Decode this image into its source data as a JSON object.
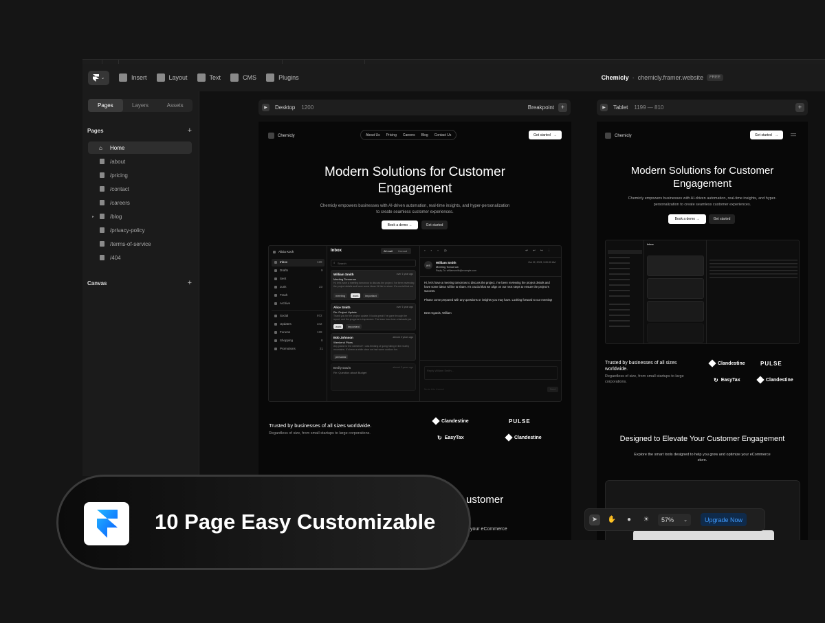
{
  "toolbar": {
    "insert": "Insert",
    "layout": "Layout",
    "text": "Text",
    "cms": "CMS",
    "plugins": "Plugins",
    "site_name": "Chemicly",
    "separator": "·",
    "domain": "chemicly.framer.website",
    "plan": "FREE"
  },
  "sidebar": {
    "tabs": [
      "Pages",
      "Layers",
      "Assets"
    ],
    "pages_title": "Pages",
    "pages": [
      "Home",
      "/about",
      "/pricing",
      "/contact",
      "/careers",
      "/blog",
      "/privacy-policy",
      "/terms-of-service",
      "/404"
    ],
    "canvas_title": "Canvas"
  },
  "desktop_bar": {
    "name": "Desktop",
    "dims": "1200",
    "breakpoint": "Breakpoint"
  },
  "tablet_bar": {
    "name": "Tablet",
    "dims": "1199 — 810"
  },
  "site": {
    "logo": "Chemicly",
    "nav": [
      "About Us",
      "Pricing",
      "Careers",
      "Blog",
      "Contact Us"
    ],
    "get_started": "Get started",
    "hero_title_1": "Modern Solutions for Customer",
    "hero_title_2": "Engagement",
    "hero_sub_1": "Chemicly empowers businesses with AI-driven automation, real-time insights, and hyper-personalization",
    "hero_sub_2": "to create seamless customer experiences.",
    "tablet_sub_1": "Chemicly empowers businesses with AI-driven automation, real-time insights, and hyper-",
    "tablet_sub_2": "personalization to create seamless customer experiences.",
    "book_demo": "Book a demo",
    "trusted": "Trusted by businesses of all sizes worldwide.",
    "trusted_t1": "Trusted by businesses of all sizes",
    "trusted_t2": "worldwide.",
    "regardless": "Regardless of size, from small startups to large corporations.",
    "regardless_t1": "Regardless of size, from small startups to large",
    "regardless_t2": "corporations.",
    "brands": [
      "Clandestine",
      "PULSE",
      "EasyTax",
      "Clandestine"
    ],
    "designed": "Designed to Elevate Your Customer Engagement",
    "explore_1": "Explore the smart tools designed to help you grow and optimize your eCommerce",
    "explore_2": "store.",
    "cut_1": "ustomer",
    "cut_2": "your eCommerce"
  },
  "inbox": {
    "account": "Alicia Koch",
    "title": "Inbox",
    "all_mail": "All mail",
    "unread": "Unread",
    "search": "Search",
    "folders": [
      {
        "name": "Inbox",
        "count": "128"
      },
      {
        "name": "Drafts",
        "count": "9"
      },
      {
        "name": "Sent",
        "count": ""
      },
      {
        "name": "Junk",
        "count": "23"
      },
      {
        "name": "Trash",
        "count": ""
      },
      {
        "name": "Archive",
        "count": ""
      }
    ],
    "categories": [
      {
        "name": "Social",
        "count": "972"
      },
      {
        "name": "Updates",
        "count": "342"
      },
      {
        "name": "Forums",
        "count": "128"
      },
      {
        "name": "Shopping",
        "count": "8"
      },
      {
        "name": "Promotions",
        "count": "21"
      }
    ],
    "mails": [
      {
        "from": "William Smith",
        "time": "over 1 year ago",
        "subject": "Meeting Tomorrow",
        "preview": "Hi, let's have a meeting tomorrow to discuss the project. I've been reviewing the project details and have some ideas I'd like to share. It's crucial that we align on our next steps to ensure the project's success.",
        "tags": [
          "meeting",
          "work",
          "important"
        ]
      },
      {
        "from": "Alice Smith",
        "time": "over 1 year ago",
        "subject": "Re: Project Update",
        "preview": "Thank you for the project update. It looks great! I've gone through the report, and the progress is impressive. The team has done a fantastic job.",
        "tags": [
          "work",
          "important"
        ]
      },
      {
        "from": "Bob Johnson",
        "time": "almost 2 years ago",
        "subject": "Weekend Plans",
        "preview": "Any plans for the weekend? I was thinking of going hiking in the nearby mountains. It's been a while since we had some outdoor fun.",
        "tags": [
          "personal"
        ]
      },
      {
        "from": "Emily Davis",
        "time": "almost 2 years ago",
        "subject": "Re: Question about Budget",
        "preview": "",
        "tags": []
      }
    ],
    "reader": {
      "from": "William Smith",
      "subject": "Meeting Tomorrow",
      "reply_to": "Reply-To: williamsmith@example.com",
      "date": "Oct 22, 2023, 9:00:00 AM",
      "body_1": "Hi, let's have a meeting tomorrow to discuss the project. I've been reviewing the project details and have some ideas I'd like to share. It's crucial that we align on our next steps to ensure the project's success.",
      "body_2": "Please come prepared with any questions or insights you may have. Looking forward to our meeting!",
      "body_3": "Best regards, William",
      "reply_placeholder": "Reply William Smith...",
      "mute": "Mute this thread",
      "send": "Send",
      "avatar": "WS"
    }
  },
  "promo": {
    "headline": "10 Page Easy Customizable"
  },
  "floating": {
    "zoom": "57%",
    "upgrade": "Upgrade Now"
  }
}
